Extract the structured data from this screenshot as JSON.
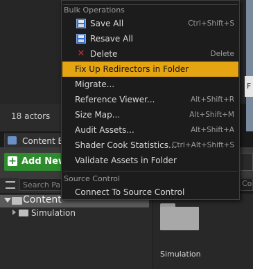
{
  "editor": {
    "actor_count": "18 actors",
    "preview_tab_char": "F"
  },
  "content_browser": {
    "tab_label": "Content Br",
    "add_new_label": "Add New",
    "search_paths_placeholder": "Search Pa",
    "right_search_stub": "Co",
    "tree": [
      {
        "label": "Content",
        "expanded": true,
        "selected": true
      },
      {
        "label": "Simulation",
        "expanded": false,
        "selected": false
      }
    ],
    "assets": [
      {
        "label": "Simulation",
        "type": "folder"
      }
    ]
  },
  "context_menu": {
    "sections": [
      {
        "header": "Bulk Operations",
        "items": [
          {
            "label": "Save All",
            "shortcut": "Ctrl+Shift+S",
            "icon": "floppy-disk-icon"
          },
          {
            "label": "Resave All",
            "shortcut": "",
            "icon": "floppy-disk-icon"
          },
          {
            "label": "Delete",
            "shortcut": "Delete",
            "icon": "delete-icon"
          },
          {
            "label": "Fix Up Redirectors in Folder",
            "shortcut": "",
            "icon": "",
            "highlighted": true
          },
          {
            "label": "Migrate...",
            "shortcut": "",
            "icon": ""
          },
          {
            "label": "Reference Viewer...",
            "shortcut": "Alt+Shift+R",
            "icon": ""
          },
          {
            "label": "Size Map...",
            "shortcut": "Alt+Shift+M",
            "icon": ""
          },
          {
            "label": "Audit Assets...",
            "shortcut": "Alt+Shift+A",
            "icon": ""
          },
          {
            "label": "Shader Cook Statistics...",
            "shortcut": "Ctrl+Alt+Shift+S",
            "icon": ""
          },
          {
            "label": "Validate Assets in Folder",
            "shortcut": "",
            "icon": ""
          }
        ]
      },
      {
        "header": "Source Control",
        "items": [
          {
            "label": "Connect To Source Control",
            "shortcut": "",
            "icon": ""
          }
        ]
      }
    ]
  },
  "colors": {
    "highlight": "#e5a513",
    "add_new_green": "#2e8b2e",
    "menu_bg": "#1c1c1c"
  }
}
